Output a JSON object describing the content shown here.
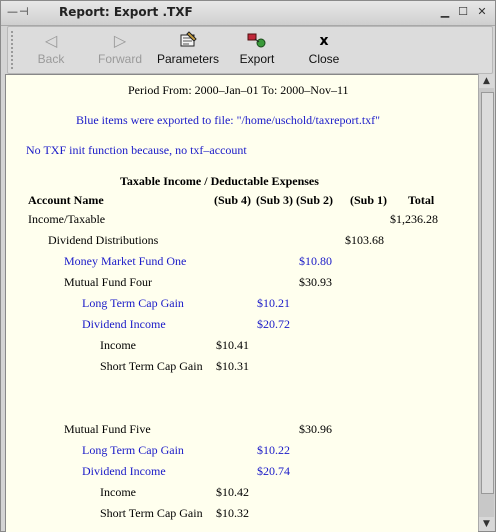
{
  "window": {
    "title": "Report: Export .TXF",
    "menu_glyph": "—⊣"
  },
  "toolbar": {
    "back": "Back",
    "forward": "Forward",
    "parameters": "Parameters",
    "export": "Export",
    "close": "Close",
    "back_icon": "◁",
    "forward_icon": "▷",
    "close_icon": "x"
  },
  "report": {
    "period": "Period From: 2000–Jan–01 To: 2000–Nov–11",
    "exported_msg": "Blue items were exported to file: \"/home/uschold/taxreport.txf\"",
    "no_init": "No TXF init function because, no txf–account",
    "heading": "Taxable Income / Deductable Expenses",
    "columns": {
      "account": "Account Name",
      "sub4": "(Sub 4)",
      "sub3": "(Sub 3)",
      "sub2": "(Sub 2)",
      "sub1": "(Sub 1)",
      "total": "Total"
    },
    "rows": [
      {
        "name": "Income/Taxable",
        "total": "$1,236.28"
      },
      {
        "name": "Dividend Distributions",
        "sub1": "$103.68"
      },
      {
        "name": "Money Market Fund One",
        "sub2": "$10.80"
      },
      {
        "name": "Mutual Fund Four",
        "sub2": "$30.93"
      },
      {
        "name": "Long Term Cap Gain",
        "sub3": "$10.21"
      },
      {
        "name": "Dividend Income",
        "sub3": "$20.72"
      },
      {
        "name": "Income",
        "sub4": "$10.41"
      },
      {
        "name": "Short Term Cap Gain",
        "sub4": "$10.31"
      },
      {
        "name": "Mutual Fund Five",
        "sub2": "$30.96"
      },
      {
        "name": "Long Term Cap Gain",
        "sub3": "$10.22"
      },
      {
        "name": "Dividend Income",
        "sub3": "$20.74"
      },
      {
        "name": "Income",
        "sub4": "$10.42"
      },
      {
        "name": "Short Term Cap Gain",
        "sub4": "$10.32"
      }
    ]
  },
  "colors": {
    "exported": "#1a1ac8",
    "background": "#ffffee"
  }
}
